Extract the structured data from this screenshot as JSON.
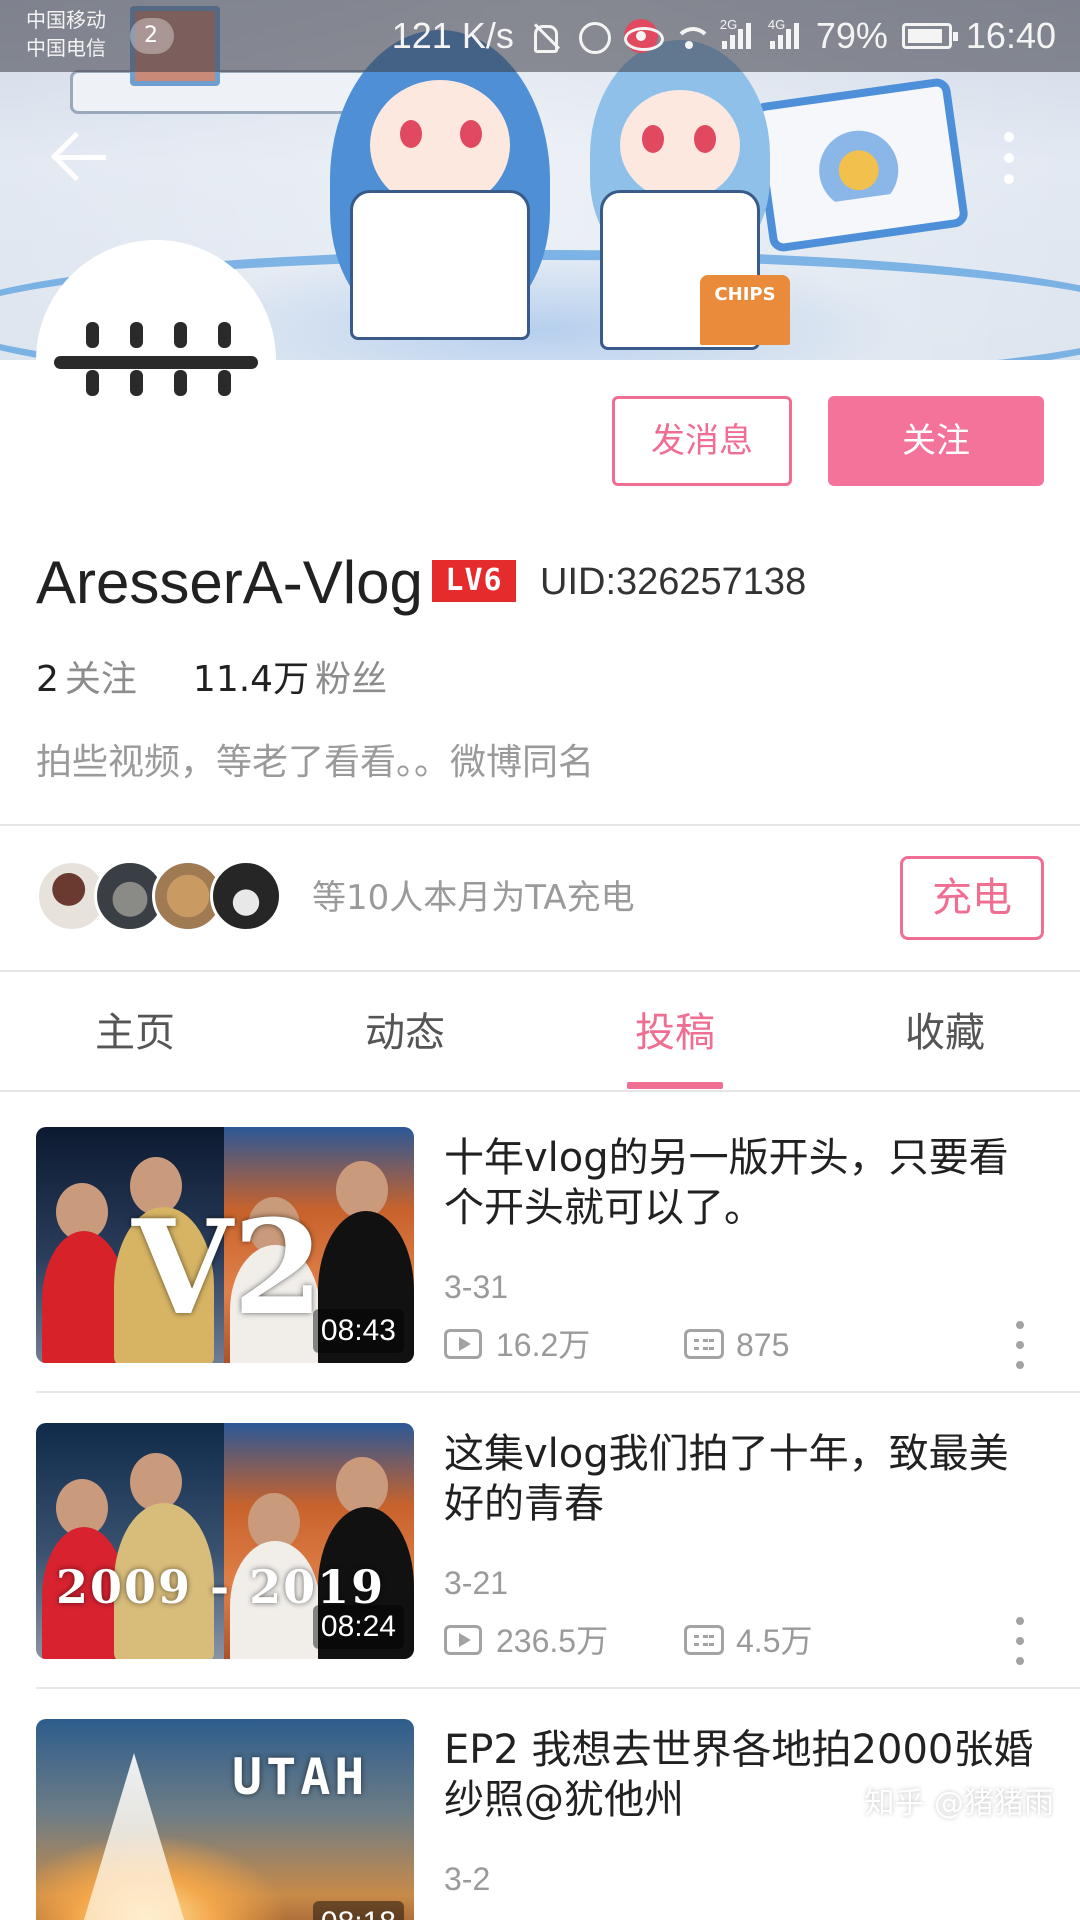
{
  "status_bar": {
    "carrier_1": "中国移动",
    "carrier_2": "中国电信",
    "notification_count": "2",
    "net_speed": "121 K/s",
    "net_2g": "2G",
    "net_4g": "4G",
    "battery": "79%",
    "time": "16:40"
  },
  "banner": {
    "chips_text": "CHIPS"
  },
  "profile": {
    "username": "AresserA-Vlog",
    "level": "LV6",
    "uid": "UID:326257138",
    "following_count": "2",
    "following_label": "关注",
    "fans_count": "11.4万",
    "fans_label": "粉丝",
    "bio": "拍些视频，等老了看看。。微博同名"
  },
  "actions": {
    "message_label": "发消息",
    "follow_label": "关注"
  },
  "charge": {
    "text": "等10人本月为TA充电",
    "button_label": "充电"
  },
  "tabs": [
    {
      "label": "主页",
      "active": false
    },
    {
      "label": "动态",
      "active": false
    },
    {
      "label": "投稿",
      "active": true
    },
    {
      "label": "收藏",
      "active": false
    }
  ],
  "videos": [
    {
      "title": "十年vlog的另一版开头，只要看个开头就可以了。",
      "date": "3-31",
      "views": "16.2万",
      "comments": "875",
      "duration": "08:43",
      "thumb_text": "V2"
    },
    {
      "title": "这集vlog我们拍了十年，致最美好的青春",
      "date": "3-21",
      "views": "236.5万",
      "comments": "4.5万",
      "duration": "08:24",
      "thumb_text": "2009 - 2019"
    },
    {
      "title": "EP2 我想去世界各地拍2000张婚纱照@犹他州",
      "date": "3-2",
      "views": "",
      "comments": "",
      "duration": "08:18",
      "thumb_text": "UTAH"
    }
  ],
  "watermark": {
    "text": "知乎 @猪猪雨"
  },
  "colors": {
    "accent_pink": "#f06e92",
    "follow_bg": "#f4739a",
    "level_red": "#e52b2b"
  },
  "icons": [
    "back-arrow-icon",
    "more-vertical-icon",
    "play-icon",
    "danmaku-icon",
    "wifi-icon",
    "alarm-icon",
    "mute-icon",
    "eye-icon",
    "battery-icon"
  ]
}
